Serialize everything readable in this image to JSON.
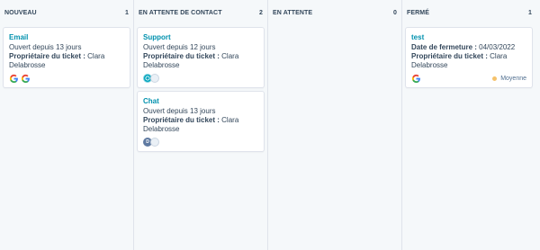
{
  "columns": [
    {
      "title": "NOUVEAU",
      "count": "1",
      "cards": [
        {
          "title": "Email",
          "open_since": "Ouvert depuis 13 jours",
          "owner_label": "Propriétaire du ticket :",
          "owner_value": "Clara Delabrosse"
        }
      ]
    },
    {
      "title": "EN ATTENTE DE CONTACT",
      "count": "2",
      "cards": [
        {
          "title": "Support",
          "open_since": "Ouvert depuis 12 jours",
          "owner_label": "Propriétaire du ticket :",
          "owner_value": "Clara Delabrosse"
        },
        {
          "title": "Chat",
          "open_since": "Ouvert depuis 13 jours",
          "owner_label": "Propriétaire du ticket :",
          "owner_value": "Clara Delabrosse",
          "avatar_initial": "D"
        }
      ]
    },
    {
      "title": "EN ATTENTE",
      "count": "0",
      "cards": []
    },
    {
      "title": "FERMÉ",
      "count": "1",
      "cards": [
        {
          "title": "test",
          "close_label": "Date de fermeture :",
          "close_value": "04/03/2022",
          "owner_label": "Propriétaire du ticket :",
          "owner_value": "Clara Delabrosse",
          "priority": "Moyenne"
        }
      ]
    }
  ],
  "colors": {
    "accent": "#0091ae",
    "text": "#33475b",
    "priority_medium": "#f5c26b",
    "background": "#f5f8fa"
  },
  "icons": [
    "google-icon",
    "avatar-icon"
  ]
}
